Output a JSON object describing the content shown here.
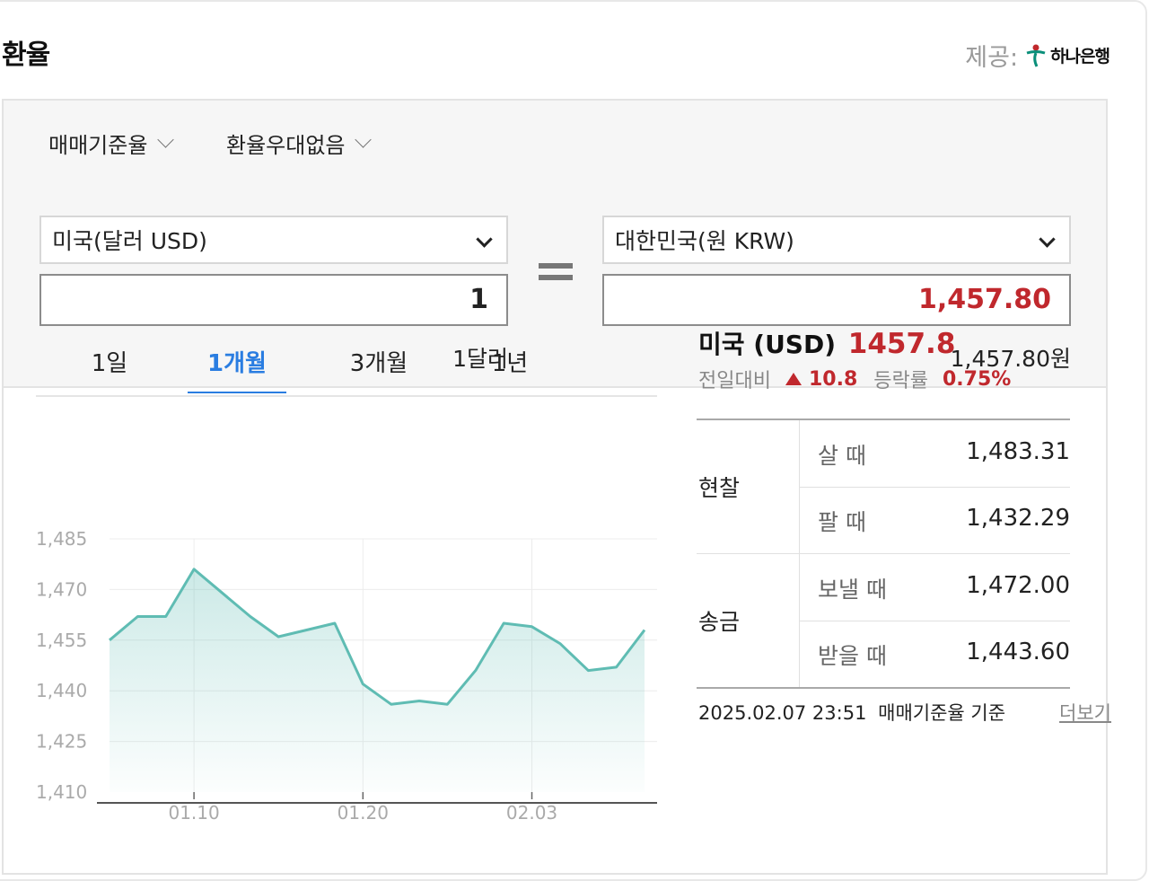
{
  "header": {
    "title": "환율",
    "provider_label": "제공:",
    "provider_name": "하나은행"
  },
  "filters": {
    "rate_type": "매매기준율",
    "preference": "환율우대없음"
  },
  "converter": {
    "from_currency": "미국(달러 USD)",
    "to_currency": "대한민국(원 KRW)",
    "from_amount": "1",
    "to_amount": "1,457.80",
    "from_unit": "1달러",
    "to_unit": "1,457.80원"
  },
  "tabs": [
    "1일",
    "1개월",
    "3개월",
    "1년"
  ],
  "active_tab": "1개월",
  "summary": {
    "title": "미국 (USD)",
    "rate": "1457.8",
    "change_label": "전일대비",
    "change_value": "10.8",
    "change_rate_label": "등락률",
    "change_rate": "0.75%"
  },
  "rate_table": {
    "cash": {
      "label": "현찰",
      "buy_label": "살 때",
      "buy_value": "1,483.31",
      "sell_label": "팔 때",
      "sell_value": "1,432.29"
    },
    "remittance": {
      "label": "송금",
      "send_label": "보낼 때",
      "send_value": "1,472.00",
      "receive_label": "받을 때",
      "receive_value": "1,443.60"
    }
  },
  "footer": {
    "timestamp": "2025.02.07 23:51",
    "basis": "매매기준율 기준",
    "more_link": "더보기"
  },
  "colors": {
    "accent_blue": "#2a7de1",
    "up_red": "#c0282d",
    "line": "#5fbcb3"
  },
  "chart_data": {
    "type": "area",
    "x_ticks": [
      "01.10",
      "01.20",
      "02.03"
    ],
    "y_ticks": [
      1410,
      1425,
      1440,
      1455,
      1470,
      1485
    ],
    "ylim": [
      1410,
      1485
    ],
    "grid": true,
    "series": [
      {
        "values": [
          1455,
          1462,
          1462,
          1476,
          1469,
          1462,
          1456,
          1458,
          1460,
          1442,
          1436,
          1437,
          1436,
          1446,
          1460,
          1459,
          1454,
          1446,
          1447,
          1458
        ]
      }
    ]
  }
}
